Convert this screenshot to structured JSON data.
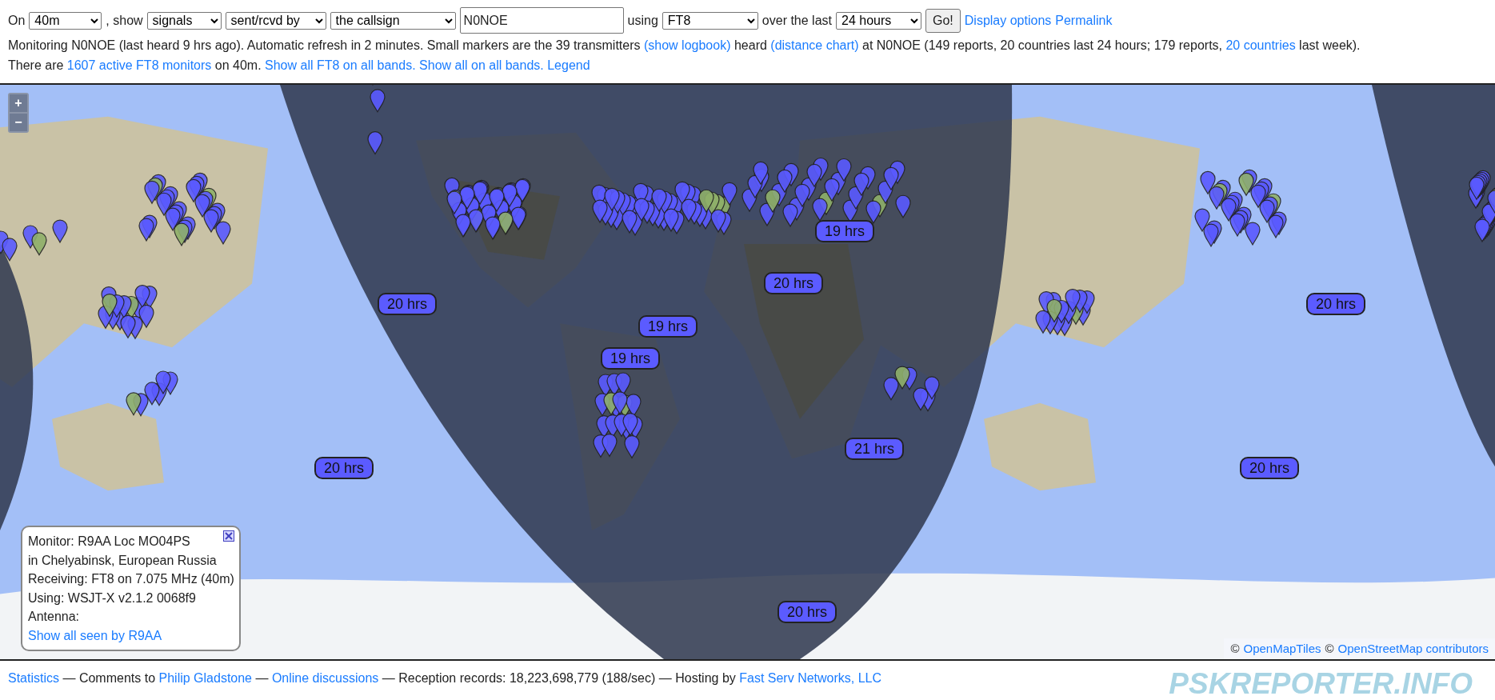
{
  "controls": [
    {
      "kind": "text",
      "text": "On"
    },
    {
      "kind": "select",
      "value": "40m"
    },
    {
      "kind": "text",
      "text": ", show"
    },
    {
      "kind": "select",
      "value": "signals"
    },
    {
      "kind": "select",
      "value": "sent/rcvd by"
    },
    {
      "kind": "select",
      "value": "the callsign"
    },
    {
      "kind": "input",
      "value": "N0NOE"
    },
    {
      "kind": "text",
      "text": "using"
    },
    {
      "kind": "select",
      "value": "FT8"
    },
    {
      "kind": "text",
      "text": "over the last"
    },
    {
      "kind": "select",
      "value": "24 hours"
    },
    {
      "kind": "button",
      "text": "Go!"
    },
    {
      "kind": "link",
      "text": "Display options"
    },
    {
      "kind": "link",
      "text": "Permalink"
    }
  ],
  "lines": [
    [
      {
        "kind": "text",
        "text": "Monitoring N0NOE (last heard 9 hrs ago). Automatic refresh in 2 minutes. Small markers are the 39 transmitters "
      },
      {
        "kind": "link",
        "text": "(show logbook)"
      },
      {
        "kind": "text",
        "text": " heard "
      },
      {
        "kind": "link",
        "text": "(distance chart)"
      },
      {
        "kind": "text",
        "text": " at N0NOE (149 reports, 20 countries last 24 hours; 179 reports, "
      },
      {
        "kind": "link",
        "text": "20 countries"
      },
      {
        "kind": "text",
        "text": " last week)."
      }
    ],
    [
      {
        "kind": "text",
        "text": "There are "
      },
      {
        "kind": "link",
        "text": "1607 active FT8 monitors"
      },
      {
        "kind": "text",
        "text": " on 40m. "
      },
      {
        "kind": "link",
        "text": "Show all FT8 on all bands."
      },
      {
        "kind": "link",
        "text": "Show all on all bands."
      },
      {
        "kind": "link",
        "text": "Legend"
      }
    ]
  ],
  "map": {
    "zoom_in": "+",
    "zoom_out": "−",
    "labels": [
      "20 hrs",
      "20 hrs",
      "21 hrs",
      "20 hrs",
      "20 hrs",
      "19 hrs",
      "19 hrs",
      "19 hrs",
      "20 hrs",
      "20 hrs"
    ],
    "popup": {
      "lines": [
        "Monitor: R9AA Loc MO04PS",
        "in Chelyabinsk, European Russia",
        "Receiving: FT8 on 7.075 MHz (40m)",
        "Using: WSJT-X v2.1.2 0068f9",
        "Antenna:"
      ],
      "link": "Show all seen by R9AA"
    },
    "attribution": [
      {
        "kind": "text",
        "text": "©"
      },
      {
        "kind": "link",
        "text": "OpenMapTiles"
      },
      {
        "kind": "text",
        "text": "©"
      },
      {
        "kind": "link",
        "text": "OpenStreetMap contributors"
      }
    ]
  },
  "footer": [
    {
      "kind": "link",
      "text": "Statistics"
    },
    {
      "kind": "text",
      "text": " — Comments to "
    },
    {
      "kind": "link",
      "text": "Philip Gladstone"
    },
    {
      "kind": "text",
      "text": " — "
    },
    {
      "kind": "link",
      "text": "Online discussions"
    },
    {
      "kind": "text",
      "text": " — Reception records: 18,223,698,779 (188/sec) — Hosting by "
    },
    {
      "kind": "link",
      "text": "Fast Serv Networks, LLC"
    }
  ],
  "logo": "PSKREPORTER.INFO"
}
